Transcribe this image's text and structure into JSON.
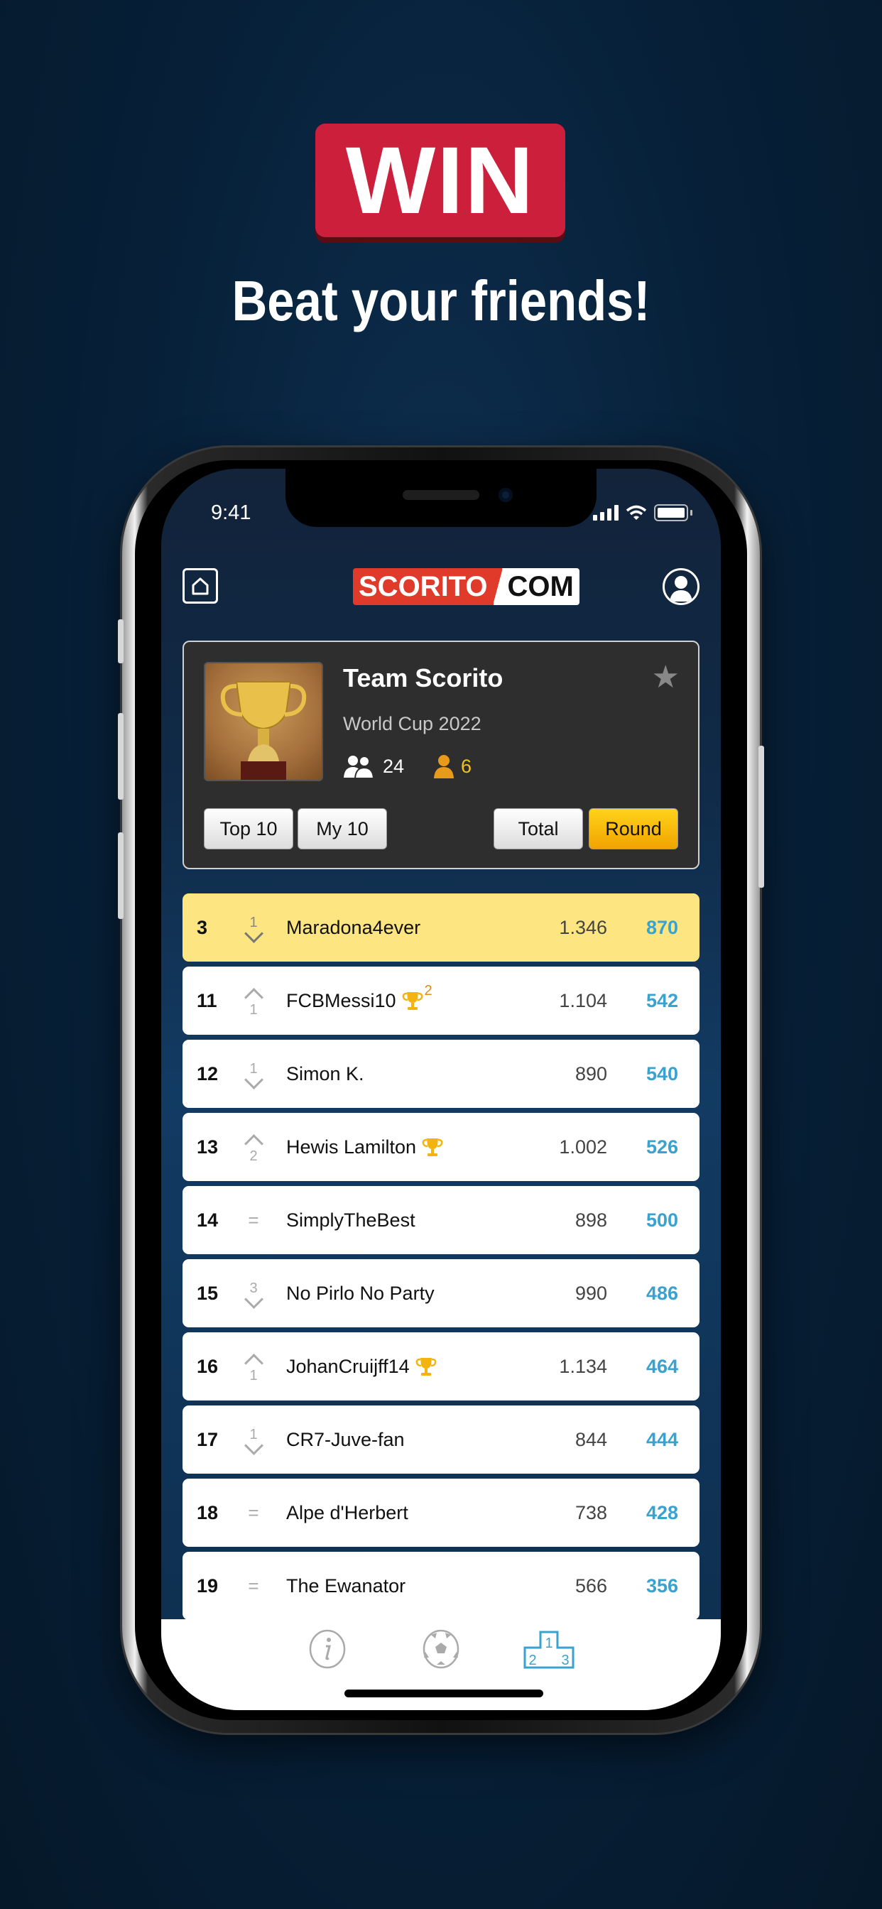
{
  "promo": {
    "badge": "WIN",
    "headline": "Beat your friends!"
  },
  "colors": {
    "accent_red": "#cc1f3c",
    "highlight_row": "#fde681",
    "active_tab": "#3aa2cf",
    "round_score": "#3aa2cf",
    "active_toggle": "#f0b400",
    "trophy_gold": "#f3b40f"
  },
  "status_bar": {
    "time": "9:41",
    "icons": [
      "signal-icon",
      "wifi-icon",
      "battery-icon"
    ]
  },
  "header": {
    "home_icon": "home-icon",
    "logo_left": "SCORITO",
    "logo_right": "COM",
    "profile_icon": "profile-icon"
  },
  "team_card": {
    "name": "Team Scorito",
    "competition": "World Cup 2022",
    "members_count": "24",
    "my_count": "6",
    "favorite_icon": "star-icon",
    "filters": [
      "Top 10",
      "My 10"
    ],
    "views": [
      "Total",
      "Round"
    ],
    "active_view": "Round"
  },
  "rankings": [
    {
      "rank": "3",
      "change_dir": "down",
      "change": "1",
      "name": "Maradona4ever",
      "trophies": "",
      "total": "1.346",
      "round": "870",
      "me": true
    },
    {
      "rank": "11",
      "change_dir": "up",
      "change": "1",
      "name": "FCBMessi10",
      "trophies": "2",
      "has_trophy": true,
      "total": "1.104",
      "round": "542"
    },
    {
      "rank": "12",
      "change_dir": "down",
      "change": "1",
      "name": "Simon K.",
      "trophies": "",
      "total": "890",
      "round": "540"
    },
    {
      "rank": "13",
      "change_dir": "up",
      "change": "2",
      "name": "Hewis Lamilton",
      "trophies": "",
      "has_trophy": true,
      "total": "1.002",
      "round": "526"
    },
    {
      "rank": "14",
      "change_dir": "same",
      "change": "=",
      "name": "SimplyTheBest",
      "trophies": "",
      "total": "898",
      "round": "500"
    },
    {
      "rank": "15",
      "change_dir": "down",
      "change": "3",
      "name": "No Pirlo No Party",
      "trophies": "",
      "total": "990",
      "round": "486"
    },
    {
      "rank": "16",
      "change_dir": "up",
      "change": "1",
      "name": "JohanCruijff14",
      "trophies": "",
      "has_trophy": true,
      "total": "1.134",
      "round": "464"
    },
    {
      "rank": "17",
      "change_dir": "down",
      "change": "1",
      "name": "CR7-Juve-fan",
      "trophies": "",
      "total": "844",
      "round": "444"
    },
    {
      "rank": "18",
      "change_dir": "same",
      "change": "=",
      "name": "Alpe d'Herbert",
      "trophies": "",
      "total": "738",
      "round": "428"
    },
    {
      "rank": "19",
      "change_dir": "same",
      "change": "=",
      "name": "The Ewanator",
      "trophies": "",
      "total": "566",
      "round": "356"
    }
  ],
  "tabbar": {
    "tabs": [
      {
        "icon": "info-icon",
        "active": false
      },
      {
        "icon": "soccer-ball-icon",
        "active": false
      },
      {
        "icon": "podium-icon",
        "active": true,
        "labels": [
          "1",
          "2",
          "3"
        ]
      }
    ]
  }
}
